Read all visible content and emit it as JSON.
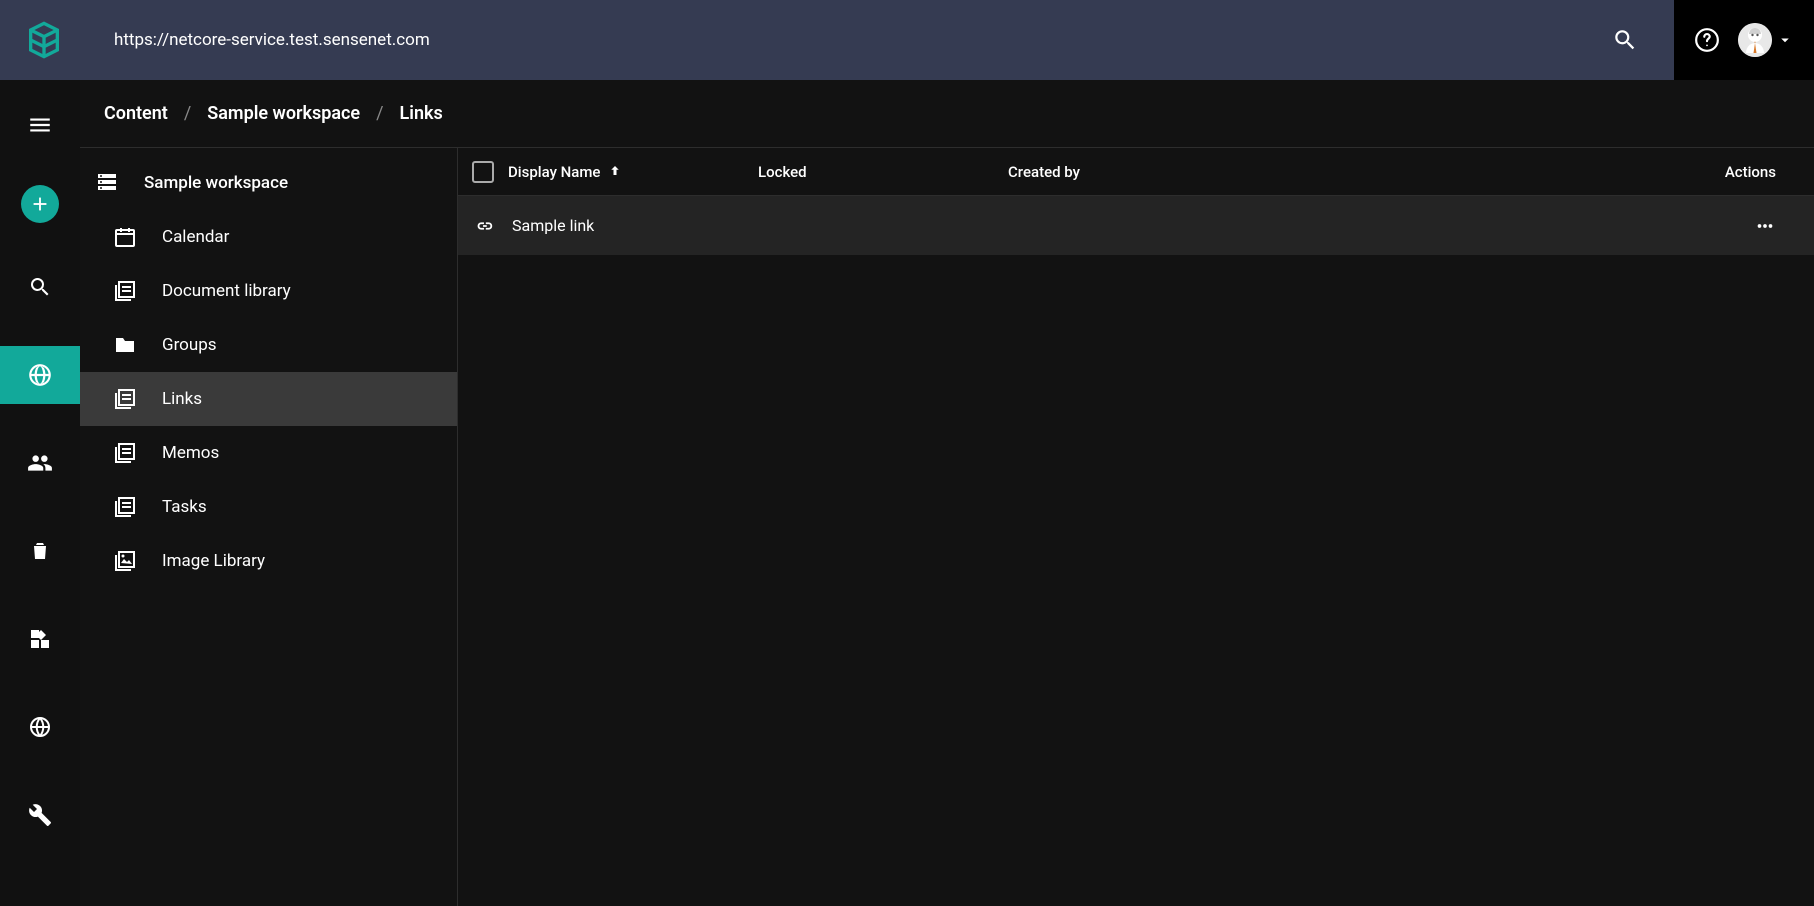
{
  "header": {
    "url": "https://netcore-service.test.sensenet.com"
  },
  "breadcrumbs": [
    {
      "label": "Content"
    },
    {
      "label": "Sample workspace"
    },
    {
      "label": "Links"
    }
  ],
  "tree": {
    "root": "Sample workspace",
    "items": [
      {
        "label": "Calendar",
        "icon": "calendar-icon"
      },
      {
        "label": "Document library",
        "icon": "library-icon"
      },
      {
        "label": "Groups",
        "icon": "folder-icon"
      },
      {
        "label": "Links",
        "icon": "library-icon",
        "selected": true
      },
      {
        "label": "Memos",
        "icon": "library-icon"
      },
      {
        "label": "Tasks",
        "icon": "library-icon"
      },
      {
        "label": "Image Library",
        "icon": "image-library-icon"
      }
    ]
  },
  "table": {
    "columns": {
      "display_name": "Display Name",
      "locked": "Locked",
      "created_by": "Created by",
      "actions": "Actions"
    },
    "rows": [
      {
        "display_name": "Sample link",
        "locked": "",
        "created_by": ""
      }
    ]
  }
}
